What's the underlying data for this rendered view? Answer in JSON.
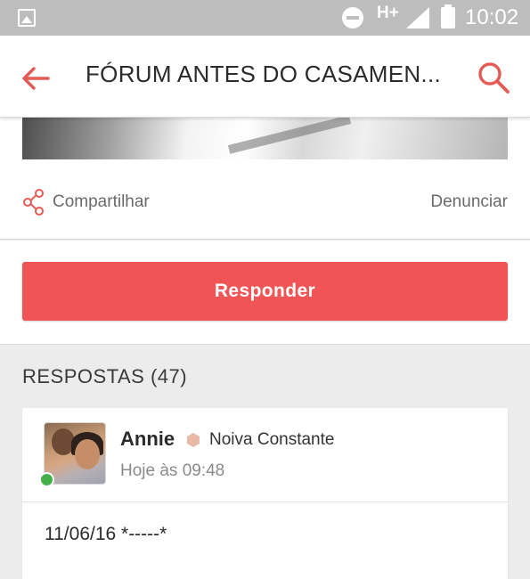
{
  "status_bar": {
    "network": "H+",
    "time": "10:02"
  },
  "app_bar": {
    "title": "FÓRUM ANTES DO CASAMEN...",
    "back_icon": "back-arrow-icon",
    "search_icon": "search-icon",
    "accent_color": "#e45b55"
  },
  "post": {
    "share_label": "Compartilhar",
    "report_label": "Denunciar"
  },
  "reply_button": {
    "label": "Responder",
    "color": "#f05454"
  },
  "replies": {
    "heading": "RESPOSTAS (47)",
    "items": [
      {
        "author": "Annie",
        "rank": "Noiva Constante",
        "time": "Hoje às 09:48",
        "text": "11/06/16 *-----*",
        "online": true
      }
    ]
  }
}
